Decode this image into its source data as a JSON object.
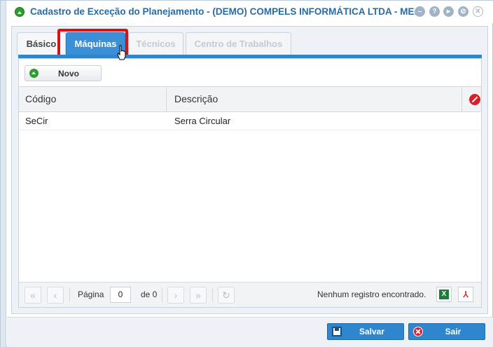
{
  "window": {
    "title": "Cadastro de Exceção do Planejamento - (DEMO) COMPELS INFORMÁTICA LTDA - ME...",
    "controls": [
      "minimize-icon",
      "help-icon",
      "play-icon",
      "settings-icon",
      "close-icon"
    ]
  },
  "tabs": [
    {
      "label": "Básico",
      "active": false,
      "enabled": true
    },
    {
      "label": "Máquinas",
      "active": true,
      "enabled": true
    },
    {
      "label": "Técnicos",
      "active": false,
      "enabled": false
    },
    {
      "label": "Centro de Trabalhos",
      "active": false,
      "enabled": false
    }
  ],
  "toolbar": {
    "new_label": "Novo"
  },
  "grid": {
    "columns": [
      "Código",
      "Descrição"
    ],
    "rows": [
      {
        "codigo": "SeCir",
        "descricao": "Serra Circular"
      }
    ]
  },
  "pager": {
    "page_label": "Página",
    "page_value": "0",
    "of_label": "de 0",
    "status": "Nenhum registro encontrado."
  },
  "footer": {
    "save_label": "Salvar",
    "exit_label": "Sair"
  },
  "colors": {
    "accent": "#2f86cf",
    "title_text": "#2a6aa3",
    "highlight": "#d6121b"
  }
}
